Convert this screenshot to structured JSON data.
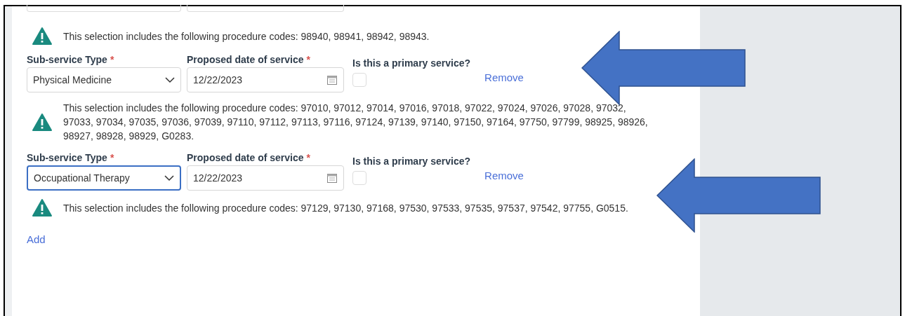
{
  "top_notice": {
    "text": "This selection includes the following procedure codes: 98940, 98941, 98942, 98943."
  },
  "services": [
    {
      "type_label": "Sub-service Type",
      "type_required_mark": "*",
      "type_value": "Physical Medicine",
      "focused": false,
      "date_label": "Proposed date of service",
      "date_required_mark": "*",
      "date_value": "12/22/2023",
      "primary_label": "Is this a primary service?",
      "primary_checked": false,
      "remove": "Remove",
      "arrow": true,
      "notice": "This selection includes the following procedure codes: 97010, 97012, 97014, 97016, 97018, 97022, 97024, 97026, 97028, 97032, 97033, 97034, 97035, 97036, 97039, 97110, 97112, 97113, 97116, 97124, 97139, 97140, 97150, 97164, 97750, 97799, 98925, 98926, 98927, 98928, 98929, G0283."
    },
    {
      "type_label": "Sub-service Type",
      "type_required_mark": "*",
      "type_value": "Occupational Therapy",
      "focused": true,
      "date_label": "Proposed date of service",
      "date_required_mark": "*",
      "date_value": "12/22/2023",
      "primary_label": "Is this a primary service?",
      "primary_checked": false,
      "remove": "Remove",
      "arrow": true,
      "notice": "This selection includes the following procedure codes: 97129, 97130, 97168, 97530, 97533, 97535, 97537, 97542, 97755, G0515."
    }
  ],
  "add": "Add"
}
